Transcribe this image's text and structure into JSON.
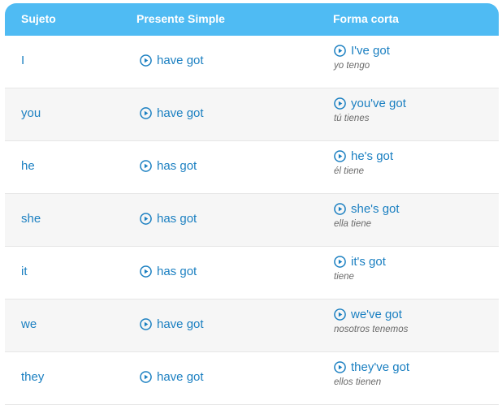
{
  "header": {
    "col1": "Sujeto",
    "col2": "Presente Simple",
    "col3": "Forma corta"
  },
  "rows": [
    {
      "subject": "I",
      "present": "have got",
      "short": "I've got",
      "translation": "yo tengo"
    },
    {
      "subject": "you",
      "present": "have got",
      "short": "you've got",
      "translation": "tú tienes"
    },
    {
      "subject": "he",
      "present": "has got",
      "short": "he's got",
      "translation": "él tiene"
    },
    {
      "subject": "she",
      "present": "has got",
      "short": "she's got",
      "translation": "ella tiene"
    },
    {
      "subject": "it",
      "present": "has got",
      "short": "it's got",
      "translation": "tiene"
    },
    {
      "subject": "we",
      "present": "have got",
      "short": "we've got",
      "translation": "nosotros tenemos"
    },
    {
      "subject": "they",
      "present": "have got",
      "short": "they've got",
      "translation": "ellos tienen"
    }
  ],
  "colors": {
    "header_bg": "#4fbbf3",
    "link": "#1a7fc1",
    "translation": "#6a6a6a"
  },
  "icons": {
    "play": "play-circle-icon"
  }
}
